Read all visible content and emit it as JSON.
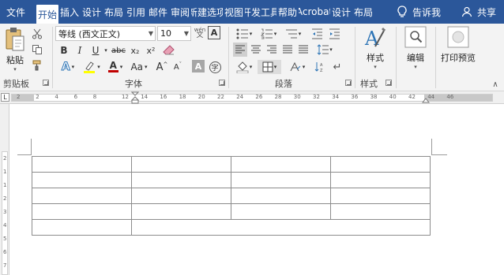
{
  "menu": {
    "tabs": [
      "文件",
      "开始",
      "插入",
      "设计",
      "布局",
      "引用",
      "邮件",
      "审阅",
      "新建选项",
      "视图",
      "开发工具",
      "帮助",
      "Acrobat",
      "设计",
      "布局"
    ],
    "active_index": 1,
    "tell_me": "告诉我",
    "share": "共享"
  },
  "ribbon": {
    "clipboard": {
      "paste_label": "粘贴",
      "group_label": "剪贴板"
    },
    "font": {
      "font_name": "等线 (西文正文)",
      "font_size": "10",
      "group_label": "字体",
      "bold": "B",
      "italic": "I",
      "underline": "U",
      "strike": "abc",
      "subscript": "x₂",
      "superscript": "x²",
      "grow": "A",
      "shrink": "A",
      "case": "Aa",
      "char_border": "A",
      "wen": "wén",
      "clear_format": "A"
    },
    "paragraph": {
      "group_label": "段落"
    },
    "styles": {
      "label": "样式",
      "group_label": "样式"
    },
    "editing": {
      "label": "编辑"
    },
    "print_preview": {
      "label": "打印预览"
    }
  },
  "ruler": {
    "numbers": [
      "2",
      "2",
      "4",
      "6",
      "8",
      "12",
      "14",
      "16",
      "18",
      "20",
      "22",
      "24",
      "26",
      "28",
      "30",
      "32",
      "34",
      "36",
      "38",
      "40",
      "42",
      "44",
      "46"
    ],
    "vertical_numbers": [
      "2",
      "1",
      "1",
      "2",
      "3",
      "4",
      "5",
      "6",
      "7"
    ]
  },
  "table": {
    "rows": [
      4,
      4,
      4,
      4,
      2
    ],
    "cells": [
      [
        "",
        "",
        "",
        ""
      ],
      [
        "",
        "",
        "",
        ""
      ],
      [
        "",
        "",
        "",
        ""
      ],
      [
        "",
        "",
        "",
        ""
      ],
      [
        "",
        ""
      ]
    ]
  },
  "colors": {
    "accent": "#2b579a",
    "ribbon_bg": "#f3f3f3",
    "page_bg": "#ffffff",
    "highlight": "#ffff00",
    "font_color": "#c00000"
  }
}
